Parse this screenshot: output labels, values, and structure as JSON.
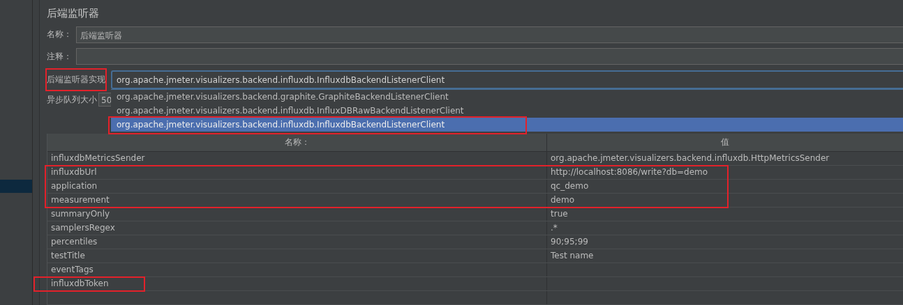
{
  "sidebar": {
    "items": [
      {
        "selected": true
      }
    ]
  },
  "title": "后端监听器",
  "name_field": {
    "label": "名称：",
    "value": "后端监听器"
  },
  "comment_field": {
    "label": "注释："
  },
  "implementation": {
    "label": "后端监听器实现",
    "annotated": true,
    "value": "org.apache.jmeter.visualizers.backend.influxdb.InfluxdbBackendListenerClient",
    "options": [
      {
        "label": "org.apache.jmeter.visualizers.backend.graphite.GraphiteBackendListenerClient",
        "selected": false,
        "annotated": false
      },
      {
        "label": "org.apache.jmeter.visualizers.backend.influxdb.InfluxDBRawBackendListenerClient",
        "selected": false,
        "annotated": false
      },
      {
        "label": "org.apache.jmeter.visualizers.backend.influxdb.InfluxdbBackendListenerClient",
        "selected": true,
        "annotated": true
      }
    ]
  },
  "queue_size": {
    "label": "异步队列大小",
    "value": "50"
  },
  "table": {
    "columns": [
      "名称：",
      "值"
    ],
    "rows": [
      {
        "name": "influxdbMetricsSender",
        "value": "org.apache.jmeter.visualizers.backend.influxdb.HttpMetricsSender",
        "annotated": false
      },
      {
        "name": "influxdbUrl",
        "value": "http://localhost:8086/write?db=demo",
        "annotated": true
      },
      {
        "name": "application",
        "value": "qc_demo",
        "annotated": true
      },
      {
        "name": "measurement",
        "value": "demo",
        "annotated": true
      },
      {
        "name": "summaryOnly",
        "value": "true",
        "annotated": false
      },
      {
        "name": "samplersRegex",
        "value": ".*",
        "annotated": false
      },
      {
        "name": "percentiles",
        "value": "90;95;99",
        "annotated": false
      },
      {
        "name": "testTitle",
        "value": "Test name",
        "annotated": false
      },
      {
        "name": "eventTags",
        "value": "",
        "annotated": false
      },
      {
        "name": "influxdbToken",
        "value": "",
        "annotated": true
      }
    ]
  }
}
